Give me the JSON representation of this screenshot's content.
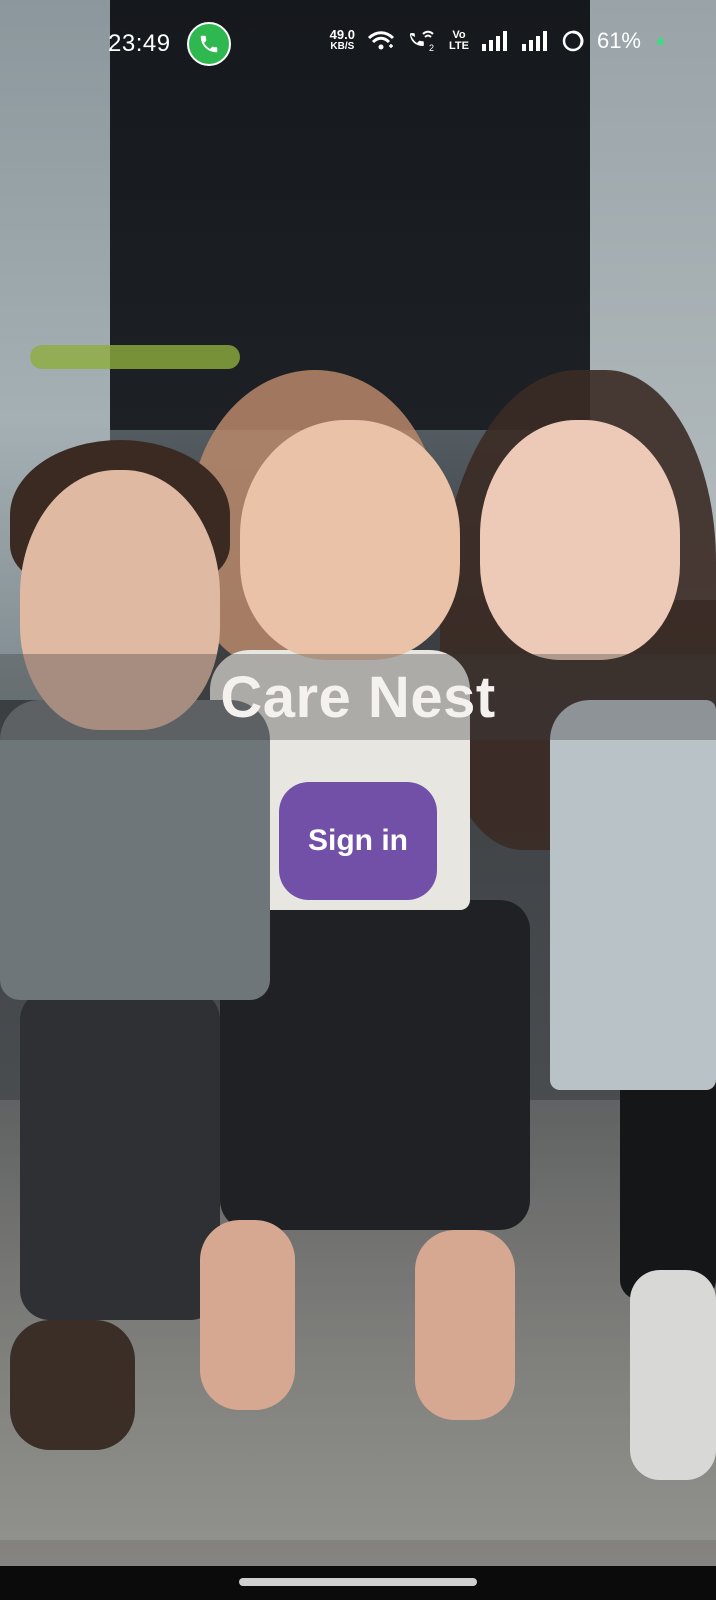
{
  "status_bar": {
    "time": "23:49",
    "net_speed_value": "49.0",
    "net_speed_unit": "KB/S",
    "volte_top": "Vo",
    "volte_bottom": "LTE",
    "battery_percent": "61%",
    "icons": [
      "phone-call-icon",
      "wifi-icon",
      "wifi-calling-icon",
      "volte-icon",
      "signal-icon",
      "signal-icon",
      "battery-icon"
    ]
  },
  "app": {
    "title": "Care Nest",
    "sign_in_label": "Sign in"
  },
  "colors": {
    "accent": "#7250a8",
    "call_badge": "#2fb750"
  }
}
